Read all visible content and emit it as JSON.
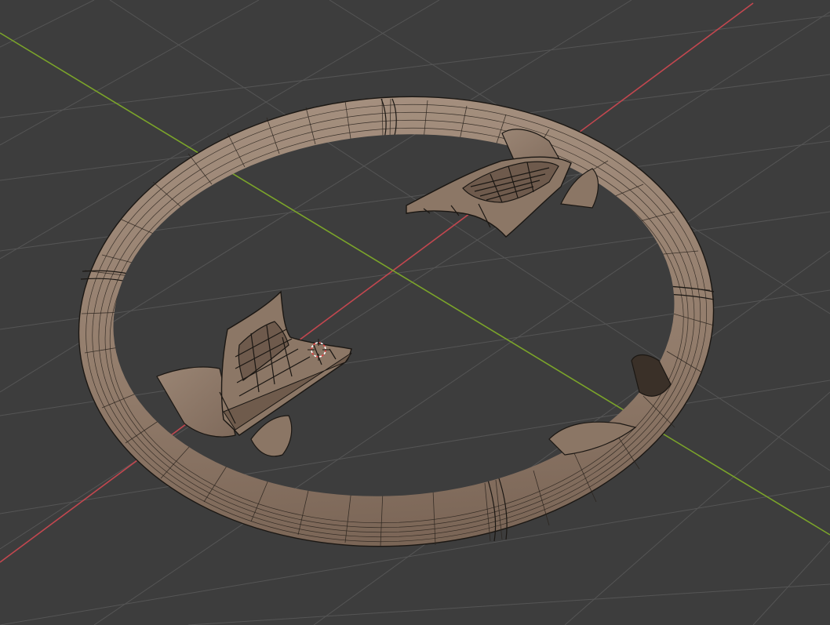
{
  "viewport": {
    "name": "3D Viewport",
    "background_color": "#3d3d3d",
    "grid_color": "#555555",
    "x_axis_color": "#c2474f",
    "y_axis_color": "#7ba42a",
    "mesh_color": "#9b8675",
    "mesh_shadow_color": "#6f5c4e",
    "wire_color": "#1b1713",
    "cursor_icon": "3d-cursor-icon",
    "cursor_color": "#e04545"
  }
}
